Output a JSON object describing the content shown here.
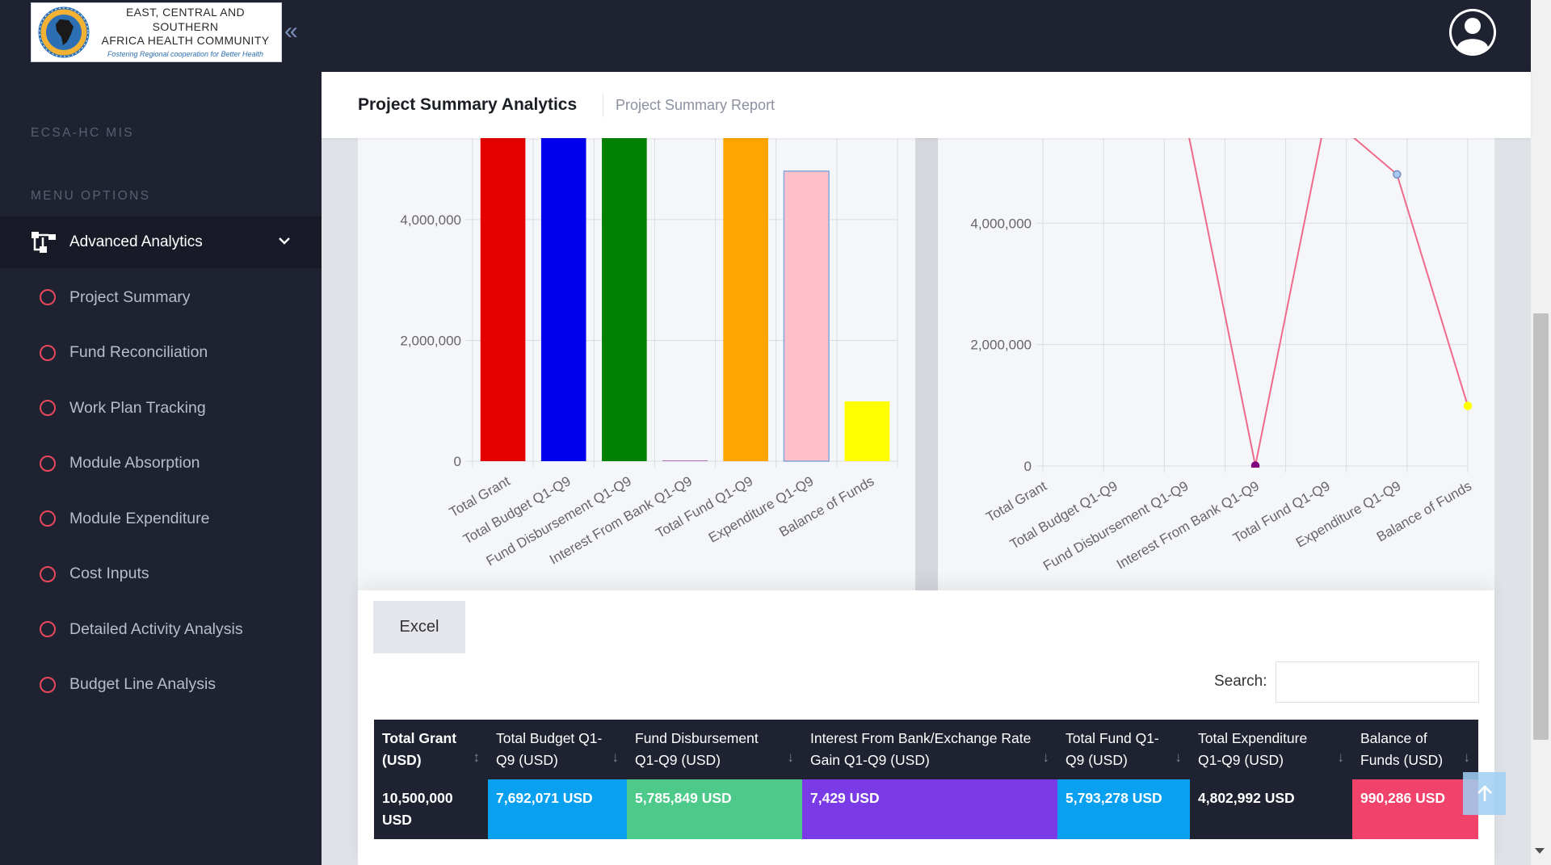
{
  "app": {
    "logo_line1": "EAST, CENTRAL AND SOUTHERN",
    "logo_line2": "AFRICA HEALTH COMMUNITY",
    "logo_tagline": "Fostering Regional cooperation for Better Health",
    "collapse_glyph": "«"
  },
  "sidebar": {
    "system_label": "ECSA-HC MIS",
    "menu_header": "MENU OPTIONS",
    "active_menu": {
      "label": "Advanced Analytics",
      "icon": "sitemap-icon"
    },
    "items": [
      {
        "label": "Project Summary"
      },
      {
        "label": "Fund Reconciliation"
      },
      {
        "label": "Work Plan Tracking"
      },
      {
        "label": "Module Absorption"
      },
      {
        "label": "Module Expenditure"
      },
      {
        "label": "Cost Inputs"
      },
      {
        "label": "Detailed Activity Analysis"
      },
      {
        "label": "Budget Line Analysis"
      }
    ]
  },
  "header": {
    "title": "Project Summary Analytics",
    "subtitle": "Project Summary Report"
  },
  "chart_data": [
    {
      "type": "bar",
      "categories": [
        "Total Grant",
        "Total Budget Q1-Q9",
        "Fund Disbursement Q1-Q9",
        "Interest From Bank Q1-Q9",
        "Total Fund Q1-Q9",
        "Expenditure Q1-Q9",
        "Balance of Funds"
      ],
      "values": [
        10500000,
        7692071,
        5785849,
        7429,
        5793278,
        4802992,
        990286
      ],
      "colors": [
        "#e50000",
        "#0000ee",
        "#008000",
        "#800080",
        "#ffa500",
        "#ffc0cb",
        "#ffff00"
      ],
      "y_ticks": [
        "0",
        "2,000,000",
        "4,000,000"
      ],
      "grid": true,
      "view_ylim": [
        0,
        5350000
      ]
    },
    {
      "type": "line",
      "categories": [
        "Total Grant",
        "Total Budget Q1-Q9",
        "Fund Disbursement Q1-Q9",
        "Interest From Bank Q1-Q9",
        "Total Fund Q1-Q9",
        "Expenditure Q1-Q9",
        "Balance of Funds"
      ],
      "values": [
        10500000,
        7692071,
        5785849,
        7429,
        5793278,
        4802992,
        990286
      ],
      "line_color": "#f06a8a",
      "point_colors": [
        "#e50000",
        "#0000ee",
        "#008000",
        "#800080",
        "#ffa500",
        "#a8c8f0",
        "#ffff00"
      ],
      "y_ticks": [
        "0",
        "2,000,000",
        "4,000,000"
      ],
      "grid": true,
      "view_ylim": [
        0,
        5400000
      ]
    }
  ],
  "table": {
    "excel_label": "Excel",
    "search_label": "Search:",
    "search_value": "",
    "headers": [
      "Total Grant (USD)",
      "Total Budget Q1-Q9 (USD)",
      "Fund Disbursement Q1-Q9 (USD)",
      "Interest From Bank/Exchange Rate Gain Q1-Q9 (USD)",
      "Total Fund Q1-Q9 (USD)",
      "Total Expenditure Q1-Q9 (USD)",
      "Balance of Funds (USD)"
    ],
    "row": [
      "10,500,000 USD",
      "7,692,071 USD",
      "5,785,849 USD",
      "7,429 USD",
      "5,793,278 USD",
      "4,802,992 USD",
      "990,286 USD"
    ],
    "cell_colors": [
      "#1e2231",
      "#0aa0f0",
      "#4dc98a",
      "#7a3ae6",
      "#0aa0f0",
      "#1e2231",
      "#f0426a"
    ],
    "sort_glyphs": [
      "↕",
      "↓",
      "↓",
      "↓",
      "↓",
      "↓",
      "↓"
    ]
  }
}
